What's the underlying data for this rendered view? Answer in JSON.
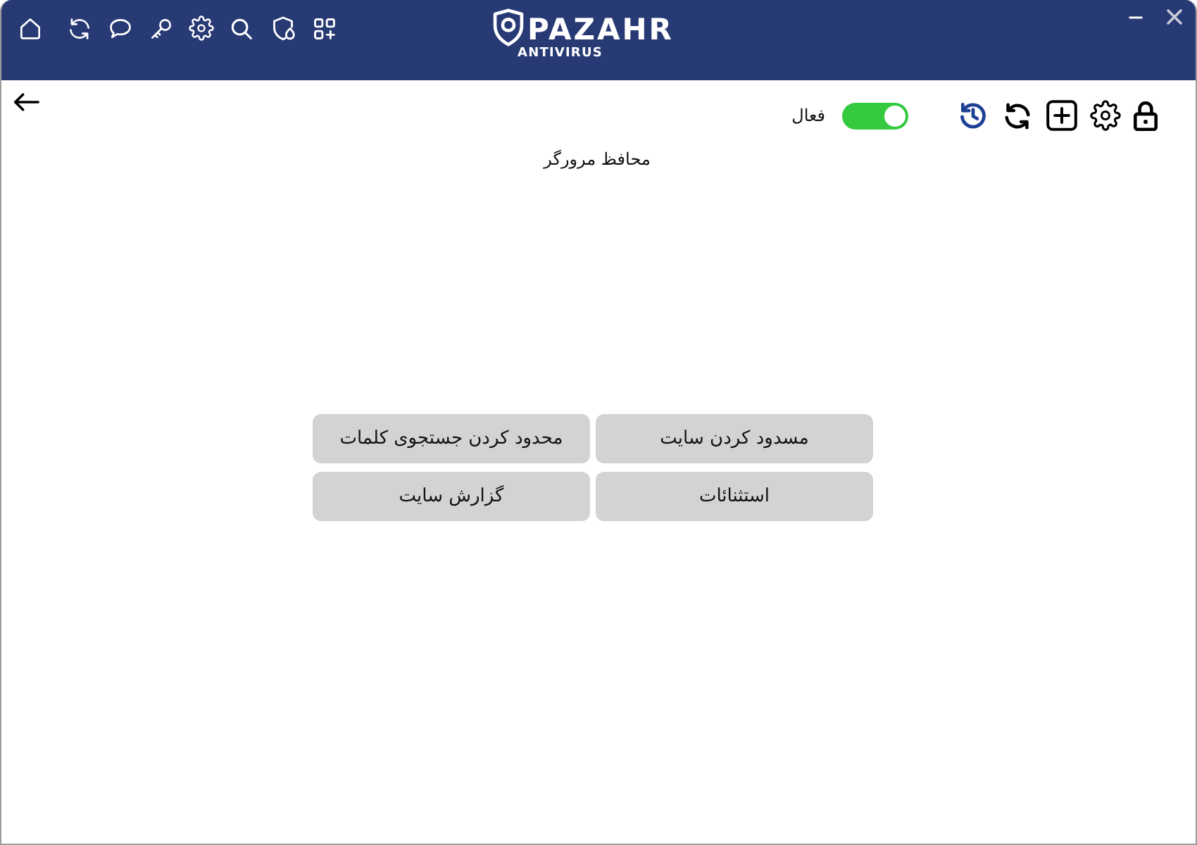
{
  "header": {
    "logo": {
      "name": "PAZAHR",
      "tagline": "ANTIVIRUS"
    }
  },
  "toolbar": {
    "status_toggle": {
      "label": "فعال",
      "on": true
    }
  },
  "page_title": "محافظ مرورگر",
  "actions": [
    {
      "label": "مسدود کردن سایت"
    },
    {
      "label": "محدود کردن جستجوی کلمات"
    },
    {
      "label": "استثنائات"
    },
    {
      "label": "گزارش سایت"
    }
  ]
}
